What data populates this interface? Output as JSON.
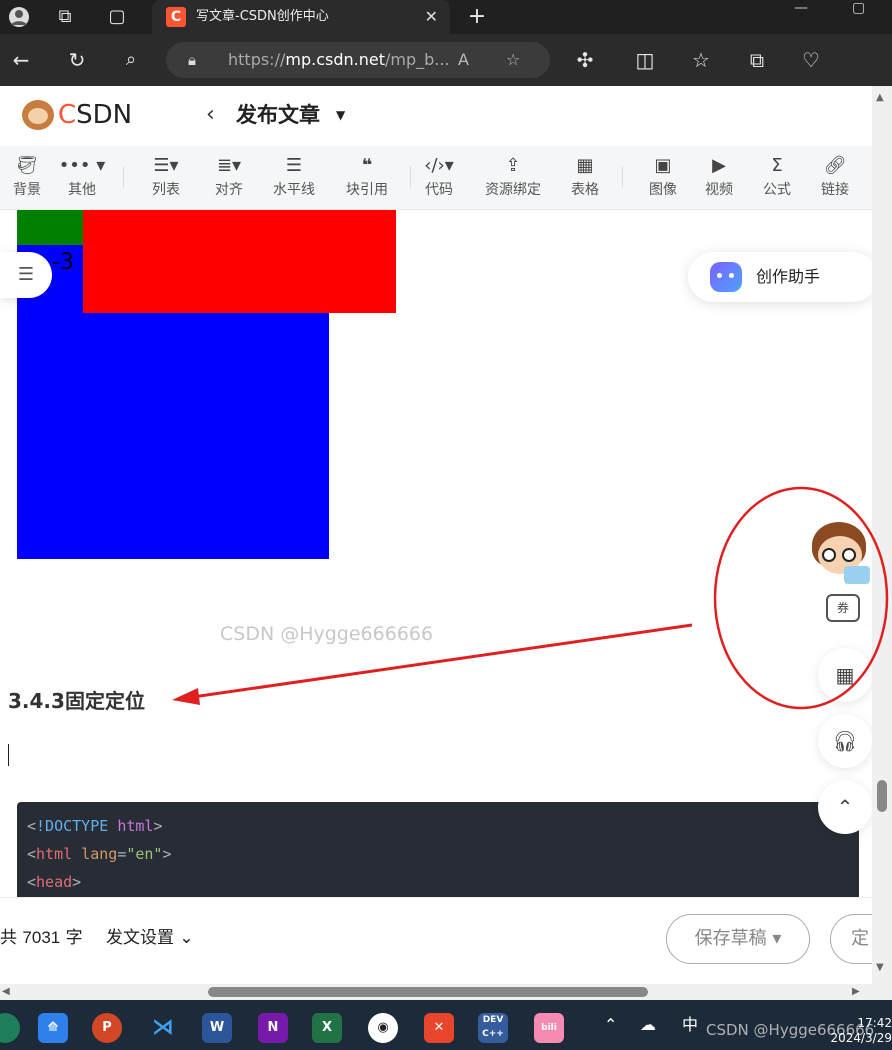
{
  "browser": {
    "tab_title": "写文章-CSDN创作中心",
    "tab_favicon": "C",
    "url_prefix": "https://",
    "url_domain": "mp.csdn.net",
    "url_rest": "/mp_b...",
    "icons": [
      "profile-icon",
      "workspaces-icon",
      "tab-actions-icon",
      "close-icon",
      "new-tab-icon",
      "back-icon",
      "refresh-icon",
      "search-icon",
      "lock-icon",
      "read-aloud-icon",
      "favorite-icon",
      "extensions-icon",
      "split-screen-icon",
      "favorites-icon",
      "collections-icon",
      "health-icon"
    ]
  },
  "header": {
    "logo_text_1": "C",
    "logo_text_2": "SDN",
    "back_label": "‹",
    "title": "发布文章"
  },
  "toolbar": {
    "tools": [
      {
        "icon": "background-icon",
        "label": "背景"
      },
      {
        "icon": "more-icon",
        "label": "其他"
      },
      {
        "icon": "list-icon",
        "label": "列表"
      },
      {
        "icon": "align-icon",
        "label": "对齐"
      },
      {
        "icon": "horizontal-line-icon",
        "label": "水平线"
      },
      {
        "icon": "quote-icon",
        "label": "块引用"
      },
      {
        "icon": "code-icon",
        "label": "代码"
      },
      {
        "icon": "resource-icon",
        "label": "资源绑定"
      },
      {
        "icon": "table-icon",
        "label": "表格"
      },
      {
        "icon": "image-icon",
        "label": "图像"
      },
      {
        "icon": "video-icon",
        "label": "视频"
      },
      {
        "icon": "formula-icon",
        "label": "公式"
      },
      {
        "icon": "link-icon",
        "label": "链接"
      }
    ]
  },
  "editor": {
    "demo_text": "-3",
    "assistant_label": "创作助手",
    "watermark": "CSDN @Hygge666666",
    "heading": "3.4.3固定定位",
    "demo_colors": {
      "green": "#008000",
      "blue": "#0000ff",
      "red": "#ff0000"
    },
    "code_lines": [
      [
        {
          "c": "pu",
          "t": "<"
        },
        {
          "c": "dt",
          "t": "!DOCTYPE"
        },
        {
          "c": "pu",
          "t": " "
        },
        {
          "c": "kw",
          "t": "html"
        },
        {
          "c": "pu",
          "t": ">"
        }
      ],
      [
        {
          "c": "pu",
          "t": "<"
        },
        {
          "c": "tg",
          "t": "html"
        },
        {
          "c": "pu",
          "t": " "
        },
        {
          "c": "at",
          "t": "lang"
        },
        {
          "c": "pu",
          "t": "="
        },
        {
          "c": "st",
          "t": "\"en\""
        },
        {
          "c": "pu",
          "t": ">"
        }
      ],
      [
        {
          "c": "pu",
          "t": "<"
        },
        {
          "c": "tg",
          "t": "head"
        },
        {
          "c": "pu",
          "t": ">"
        }
      ]
    ]
  },
  "sidebar": {
    "coupon_label": "券"
  },
  "footer": {
    "word_count_prefix": "共 ",
    "word_count": "7031",
    "word_count_suffix": " 字",
    "settings_label": "发文设置",
    "save_draft_label": "保存草稿",
    "publish_label": "定"
  },
  "taskbar": {
    "apps": [
      "browser",
      "feishu",
      "powerpoint",
      "vscode",
      "word",
      "onenote",
      "excel",
      "obs",
      "xmind",
      "devcpp",
      "bilibili"
    ],
    "ime": "中",
    "watermark": "CSDN @Hygge666666",
    "time": "17:42",
    "date": "2024/3/29"
  },
  "annotation_color": "#e02020"
}
